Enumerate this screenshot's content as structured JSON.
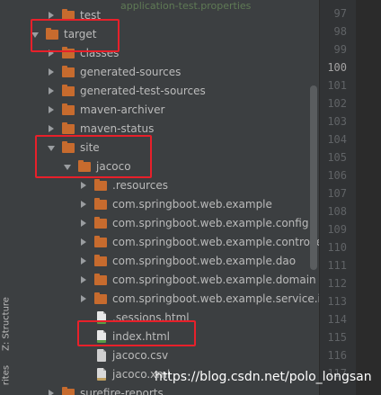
{
  "side_tabs": {
    "structure_label": "Z: Structure",
    "bottom_label": "rites"
  },
  "top_partial_text": "application-test.properties",
  "tree": {
    "items": [
      {
        "label": "test",
        "kind": "folder",
        "expanded": false,
        "depth": 2
      },
      {
        "label": "target",
        "kind": "folder",
        "expanded": true,
        "depth": 1
      },
      {
        "label": "classes",
        "kind": "folder",
        "expanded": false,
        "depth": 2
      },
      {
        "label": "generated-sources",
        "kind": "folder",
        "expanded": false,
        "depth": 2
      },
      {
        "label": "generated-test-sources",
        "kind": "folder",
        "expanded": false,
        "depth": 2
      },
      {
        "label": "maven-archiver",
        "kind": "folder",
        "expanded": false,
        "depth": 2
      },
      {
        "label": "maven-status",
        "kind": "folder",
        "expanded": false,
        "depth": 2
      },
      {
        "label": "site",
        "kind": "folder",
        "expanded": true,
        "depth": 2
      },
      {
        "label": "jacoco",
        "kind": "folder",
        "expanded": true,
        "depth": 3
      },
      {
        "label": ".resources",
        "kind": "folder",
        "expanded": false,
        "depth": 4
      },
      {
        "label": "com.springboot.web.example",
        "kind": "folder",
        "expanded": false,
        "depth": 4
      },
      {
        "label": "com.springboot.web.example.config",
        "kind": "folder",
        "expanded": false,
        "depth": 4
      },
      {
        "label": "com.springboot.web.example.controller",
        "kind": "folder",
        "expanded": false,
        "depth": 4
      },
      {
        "label": "com.springboot.web.example.dao",
        "kind": "folder",
        "expanded": false,
        "depth": 4
      },
      {
        "label": "com.springboot.web.example.domain",
        "kind": "folder",
        "expanded": false,
        "depth": 4
      },
      {
        "label": "com.springboot.web.example.service.im",
        "kind": "folder",
        "expanded": false,
        "depth": 4
      },
      {
        "label": ".sessions.html",
        "kind": "html",
        "depth": 4
      },
      {
        "label": "index.html",
        "kind": "html",
        "depth": 4
      },
      {
        "label": "jacoco.csv",
        "kind": "csv",
        "depth": 4
      },
      {
        "label": "jacoco.xml",
        "kind": "xml",
        "depth": 4
      },
      {
        "label": "surefire-reports",
        "kind": "folder",
        "expanded": false,
        "depth": 2
      }
    ]
  },
  "gutter": {
    "line_numbers": [
      "97",
      "98",
      "99",
      "100",
      "101",
      "102",
      "103",
      "104",
      "105",
      "106",
      "107",
      "108",
      "109",
      "110",
      "111",
      "112",
      "113",
      "114",
      "115",
      "116",
      "117"
    ],
    "current_line": "100"
  },
  "watermark": "https://blog.csdn.net/polo_longsan",
  "colors": {
    "highlight": "#e8202a",
    "folder": "#c76b2e",
    "background": "#3c3f41"
  }
}
